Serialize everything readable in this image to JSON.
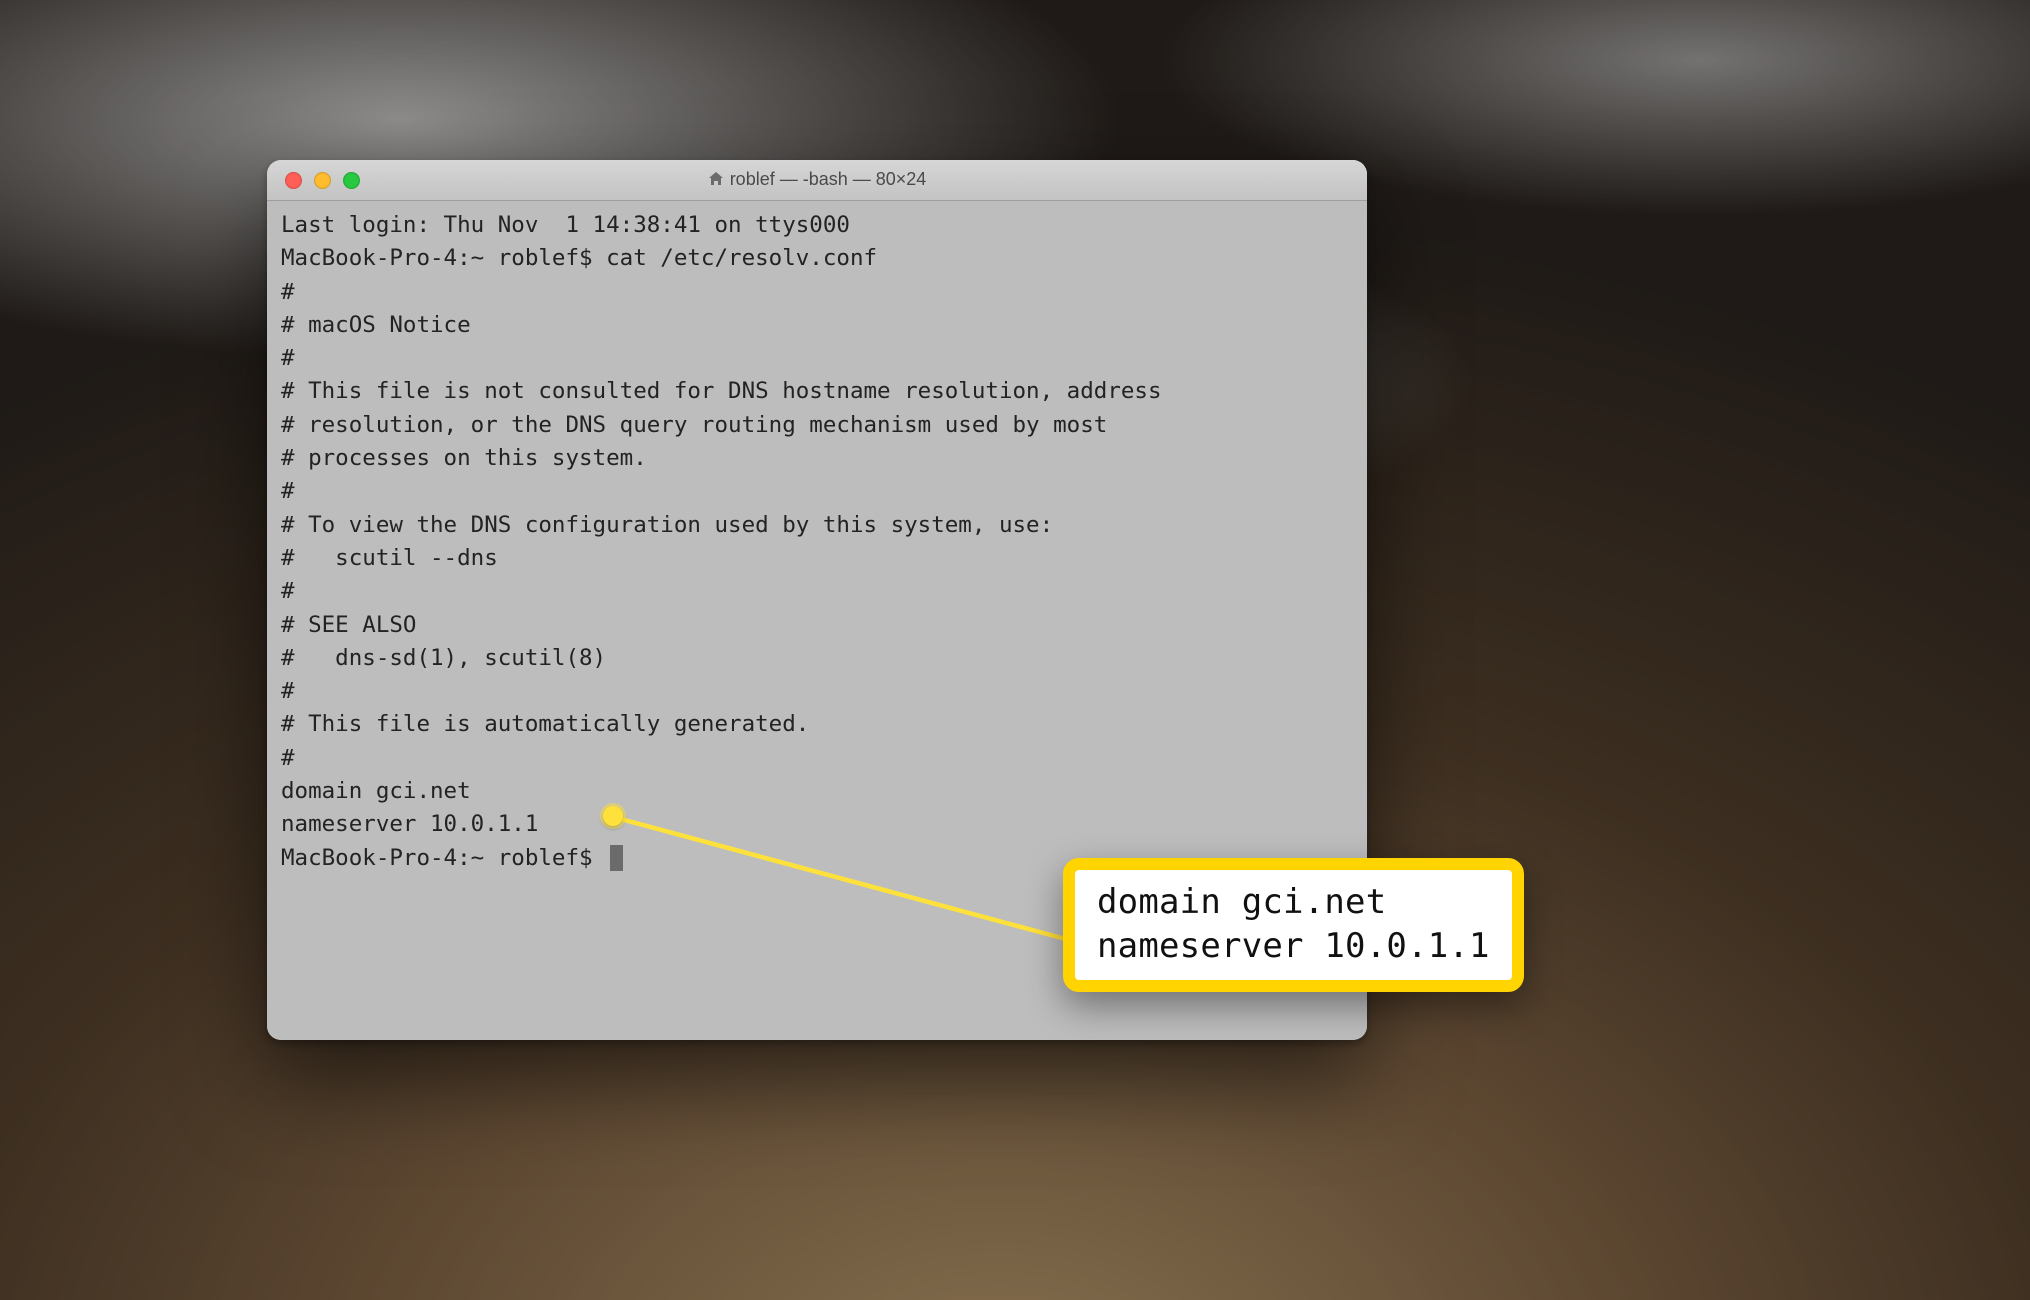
{
  "window": {
    "title": "roblef — -bash — 80×24"
  },
  "terminal": {
    "lines": [
      "Last login: Thu Nov  1 14:38:41 on ttys000",
      "MacBook-Pro-4:~ roblef$ cat /etc/resolv.conf",
      "#",
      "# macOS Notice",
      "#",
      "# This file is not consulted for DNS hostname resolution, address",
      "# resolution, or the DNS query routing mechanism used by most",
      "# processes on this system.",
      "#",
      "# To view the DNS configuration used by this system, use:",
      "#   scutil --dns",
      "#",
      "# SEE ALSO",
      "#   dns-sd(1), scutil(8)",
      "#",
      "# This file is automatically generated.",
      "#",
      "domain gci.net",
      "nameserver 10.0.1.1"
    ],
    "prompt": "MacBook-Pro-4:~ roblef$ "
  },
  "callout": {
    "line1": "domain gci.net",
    "line2": "nameserver 10.0.1.1"
  }
}
